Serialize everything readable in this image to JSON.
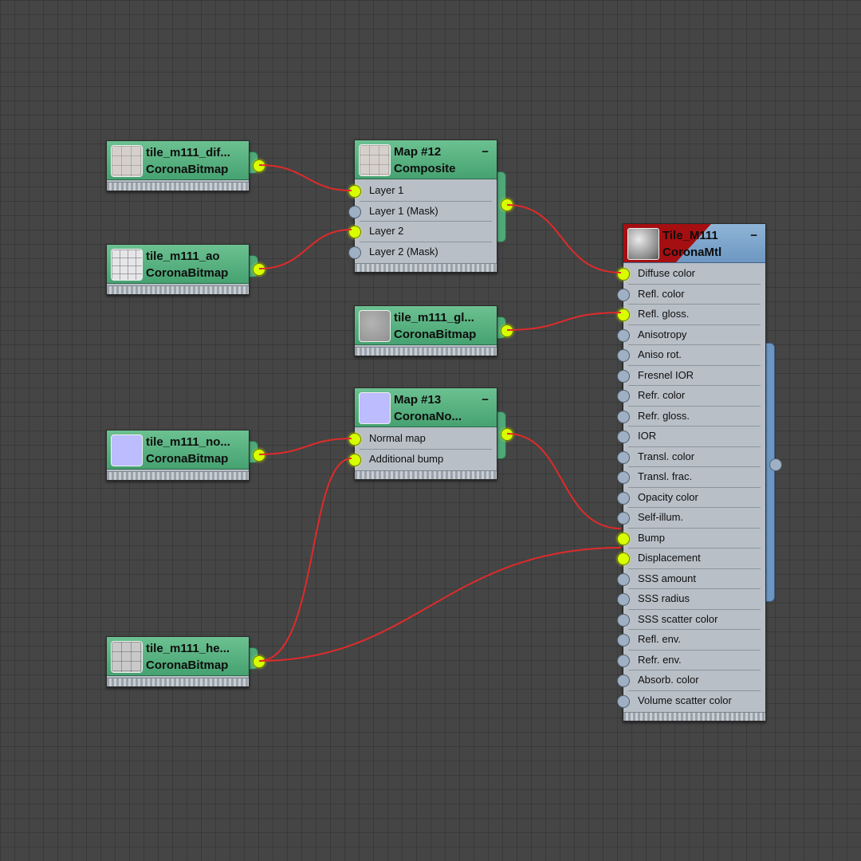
{
  "nodes": {
    "diffuse_bitmap": {
      "name": "tile_m111_dif...",
      "type": "CoronaBitmap"
    },
    "ao_bitmap": {
      "name": "tile_m111_ao",
      "type": "CoronaBitmap"
    },
    "gloss_bitmap": {
      "name": "tile_m111_gl...",
      "type": "CoronaBitmap"
    },
    "normal_bitmap": {
      "name": "tile_m111_no...",
      "type": "CoronaBitmap"
    },
    "height_bitmap": {
      "name": "tile_m111_he...",
      "type": "CoronaBitmap"
    },
    "composite": {
      "name": "Map #12",
      "type": "Composite",
      "collapse": "−",
      "slots": [
        "Layer 1",
        "Layer 1 (Mask)",
        "Layer 2",
        "Layer 2 (Mask)"
      ]
    },
    "normal_map": {
      "name": "Map #13",
      "type": "CoronaNo...",
      "collapse": "−",
      "slots": [
        "Normal map",
        "Additional bump"
      ]
    },
    "material": {
      "name": "Tile_M111",
      "type": "CoronaMtl",
      "collapse": "−",
      "slots": [
        "Diffuse color",
        "Refl. color",
        "Refl. gloss.",
        "Anisotropy",
        "Aniso rot.",
        "Fresnel IOR",
        "Refr. color",
        "Refr. gloss.",
        "IOR",
        "Transl. color",
        "Transl. frac.",
        "Opacity color",
        "Self-illum.",
        "Bump",
        "Displacement",
        "SSS amount",
        "SSS radius",
        "SSS scatter color",
        "Refl. env.",
        "Refr. env.",
        "Absorb. color",
        "Volume scatter color"
      ]
    }
  },
  "connections": [
    {
      "from": "diffuse_bitmap",
      "to": "composite",
      "slot": "Layer 1"
    },
    {
      "from": "ao_bitmap",
      "to": "composite",
      "slot": "Layer 2"
    },
    {
      "from": "composite",
      "to": "material",
      "slot": "Diffuse color"
    },
    {
      "from": "gloss_bitmap",
      "to": "material",
      "slot": "Refl. gloss."
    },
    {
      "from": "normal_bitmap",
      "to": "normal_map",
      "slot": "Normal map"
    },
    {
      "from": "height_bitmap",
      "to": "normal_map",
      "slot": "Additional bump"
    },
    {
      "from": "normal_map",
      "to": "material",
      "slot": "Bump"
    },
    {
      "from": "height_bitmap",
      "to": "material",
      "slot": "Displacement"
    }
  ],
  "colors": {
    "wire": "#e02a2a",
    "socket_connected": "#d8ff00",
    "socket_empty": "#9fb0c4",
    "map_header": "#46a271",
    "material_header": "#6d97c2",
    "material_flag": "#a50f12"
  }
}
